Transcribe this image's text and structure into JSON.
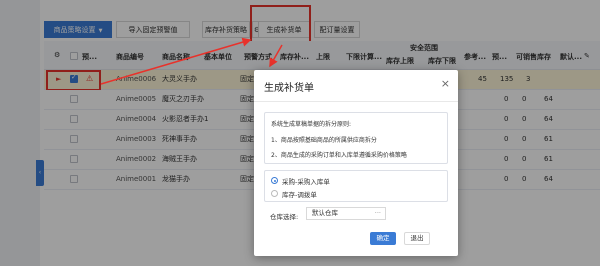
{
  "toolbar": {
    "product_settings": "商品策略设置",
    "import_alert": "导入固定预警值",
    "stock_strategy": "库存补货策略",
    "generate_order": "生成补货单",
    "quota_settings": "配订量设置"
  },
  "table": {
    "headers": {
      "pre": "预...",
      "code": "商品编号",
      "name": "商品名称",
      "unit": "基本单位",
      "forecast": "预警方式",
      "stock_sup": "库存补...",
      "upper": "上限",
      "lower_calc": "下限计算...",
      "safety": "安全范围",
      "stock_upper": "库存上限",
      "stock_lower": "库存下限",
      "ref": "参考...",
      "pre2": "预...",
      "avail": "可销售库存",
      "def": "默认..."
    },
    "rows": [
      {
        "code": "Anime0006",
        "name": "大灵义手办",
        "unit": "",
        "forecast": "固定",
        "v1": "45",
        "v2": "135",
        "v3": "3"
      },
      {
        "code": "Anime0005",
        "name": "魔灭之刃手办",
        "unit": "",
        "forecast": "固定",
        "v1": "0",
        "v2": "0",
        "v3": "64"
      },
      {
        "code": "Anime0004",
        "name": "火影忍者手办",
        "unit": "1",
        "forecast": "固定",
        "v1": "0",
        "v2": "0",
        "v3": "64"
      },
      {
        "code": "Anime0003",
        "name": "死神事手办",
        "unit": "",
        "forecast": "固定",
        "v1": "0",
        "v2": "0",
        "v3": "61"
      },
      {
        "code": "Anime0002",
        "name": "海贼王手办",
        "unit": "",
        "forecast": "固定",
        "v1": "0",
        "v2": "0",
        "v3": "61"
      },
      {
        "code": "Anime0001",
        "name": "龙猫手办",
        "unit": "",
        "forecast": "固定",
        "v1": "0",
        "v2": "0",
        "v3": "64"
      }
    ]
  },
  "modal": {
    "title": "生成补货单",
    "intro": "系统生成草稿单据的拆分原则:",
    "rule1": "1、商品按照基础商品的所属供应商拆分",
    "rule2": "2、商品生成的采购订单和入库单遵循采购价格策略",
    "option1": "采购-采购入库单",
    "option2": "库存-调拨单",
    "warehouse_label": "仓库选择:",
    "warehouse_value": "默认仓库",
    "ok": "确定",
    "quit": "退出"
  },
  "colors": {
    "accent": "#3a7bd5",
    "highlight": "#e8322b"
  }
}
